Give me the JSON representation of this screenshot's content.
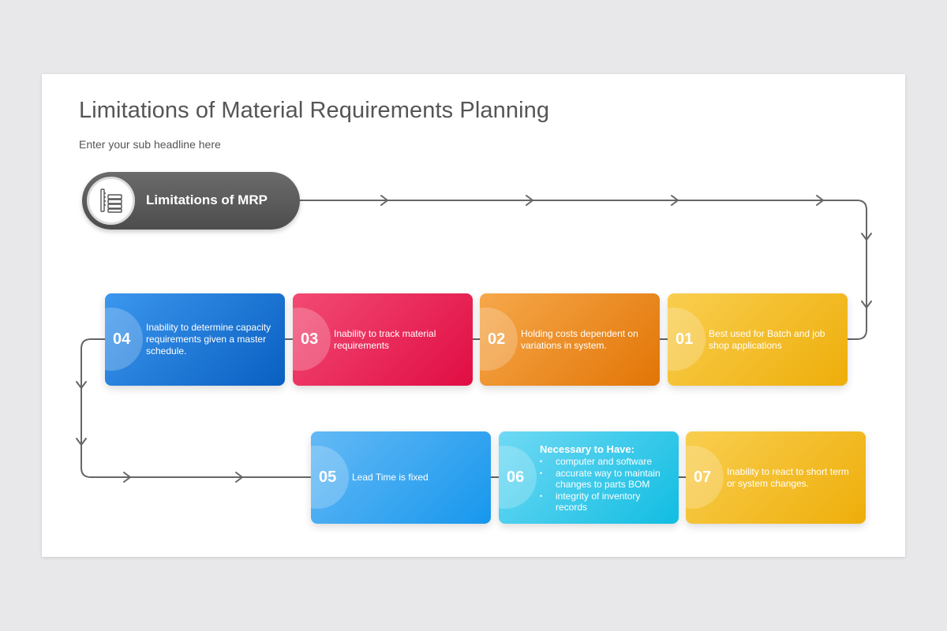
{
  "slide": {
    "title": "Limitations of Material Requirements Planning",
    "subtitle": "Enter your sub headline here"
  },
  "header_pill": {
    "label": "Limitations of MRP",
    "icon": "ruler-and-stack-icon",
    "color": "#5a5a5a"
  },
  "steps": [
    {
      "number": "01",
      "text": "Best used for Batch and job shop applications",
      "color": "#f4bf2a"
    },
    {
      "number": "02",
      "text": "Holding costs dependent on variations in system.",
      "color": "#ec8e24"
    },
    {
      "number": "03",
      "text": "Inability to track material requirements",
      "color": "#e92b5b"
    },
    {
      "number": "04",
      "text": "Inability to determine capacity requirements given a master schedule.",
      "color": "#1f7ad9"
    },
    {
      "number": "05",
      "text": "Lead Time is fixed",
      "color": "#3aa8f1"
    },
    {
      "number": "06",
      "heading": "Necessary to Have:",
      "bullets": [
        "computer and software",
        "accurate way to maintain changes to parts BOM",
        "integrity of inventory records"
      ],
      "color": "#3ccbeb"
    },
    {
      "number": "07",
      "text": "Inability to react to short term or system changes.",
      "color": "#f4bf2a"
    }
  ],
  "connector_color": "#666666"
}
